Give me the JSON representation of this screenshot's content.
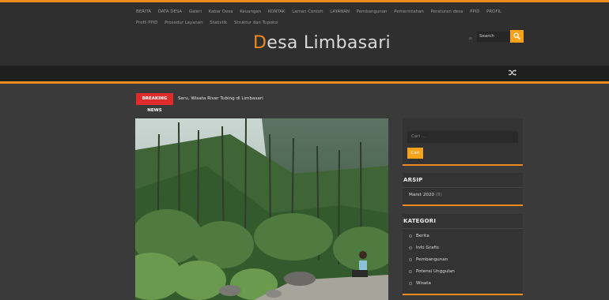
{
  "nav": {
    "row1": [
      "BERITA",
      "DATA DESA",
      "Galeri",
      "Kabar Desa",
      "Keuangan",
      "KONTAK",
      "Laman Contoh",
      "LAYANAN",
      "Pembangunan",
      "Pemerintahan",
      "Peraturan desa",
      "PPID",
      "PROFIL"
    ],
    "row2": [
      "Profil PPID",
      "Prosedur Layanan",
      "Statistik",
      "Struktur dan Tupoksi"
    ]
  },
  "logo": {
    "first_letter": "D",
    "rest": "esa Limbasari"
  },
  "search": {
    "placeholder": "Search"
  },
  "breaking": {
    "label": "BREAKING NEWS",
    "headline": "Seru, Wisata River Tubing di Limbasari"
  },
  "sidebar": {
    "search_placeholder": "Cari ...",
    "search_button": "Cari",
    "archive_title": "ARSIP",
    "archive_items": [
      {
        "label": "Maret 2020",
        "count": "(8)"
      }
    ],
    "category_title": "KATEGORI",
    "categories": [
      "Berita",
      "Info Grafis",
      "Pembangunan",
      "Potensi Unggulan",
      "Wisata"
    ]
  },
  "colors": {
    "accent": "#ef8a1c",
    "breaking": "#e02b2b",
    "search_button": "#f7a21b",
    "header_bg": "#2f2f2f",
    "body_bg": "#3a3a3a"
  }
}
